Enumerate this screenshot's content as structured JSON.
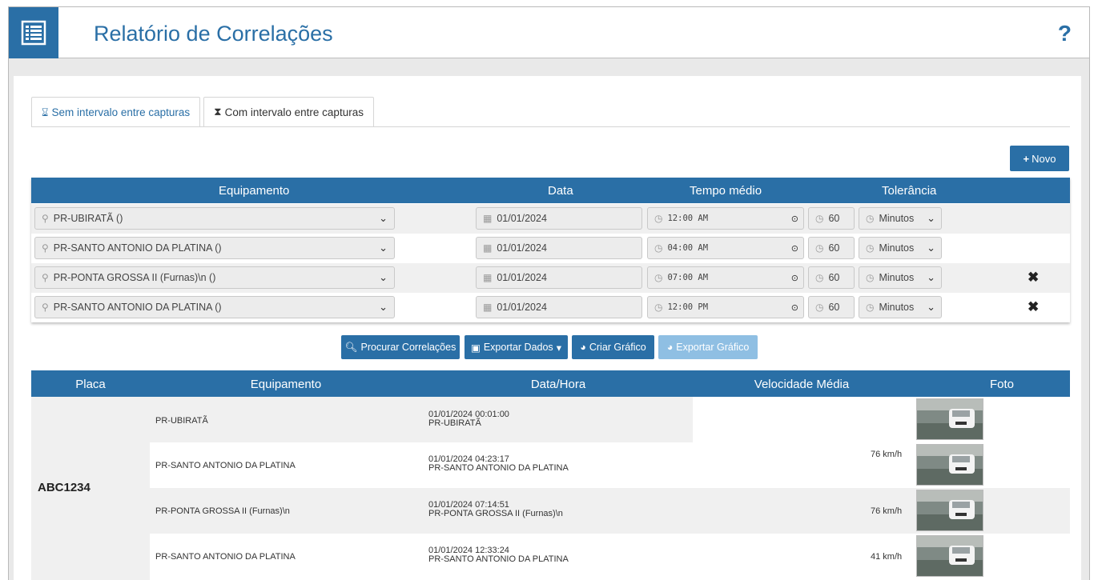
{
  "header": {
    "title": "Relatório de Correlações",
    "help": "?"
  },
  "tabs": [
    {
      "label": "Sem intervalo entre capturas",
      "icon": "hourglass-empty-icon",
      "active": true
    },
    {
      "label": "Com intervalo entre capturas",
      "icon": "hourglass-full-icon",
      "active": false
    }
  ],
  "novo_button": "Novo",
  "correlation_table": {
    "headers": {
      "equipamento": "Equipamento",
      "data": "Data",
      "tempo_medio": "Tempo médio",
      "tolerancia": "Tolerância"
    },
    "rows": [
      {
        "equipamento": "PR-UBIRATÃ ()",
        "data": "01/01/2024",
        "hora": "12:00 AM",
        "tempo": "60",
        "unidade": "Minutos",
        "removable": false
      },
      {
        "equipamento": "PR-SANTO ANTONIO DA PLATINA ()",
        "data": "01/01/2024",
        "hora": "04:00 AM",
        "tempo": "60",
        "unidade": "Minutos",
        "removable": false
      },
      {
        "equipamento": "PR-PONTA GROSSA II (Furnas)\\n ()",
        "data": "01/01/2024",
        "hora": "07:00 AM",
        "tempo": "60",
        "unidade": "Minutos",
        "removable": true
      },
      {
        "equipamento": "PR-SANTO ANTONIO DA PLATINA ()",
        "data": "01/01/2024",
        "hora": "12:00 PM",
        "tempo": "60",
        "unidade": "Minutos",
        "removable": true
      }
    ]
  },
  "actions": {
    "procurar": "Procurar Correlações",
    "exportar_dados": "Exportar Dados",
    "criar_grafico": "Criar Gráfico",
    "exportar_grafico": "Exportar Gráfico"
  },
  "results_table": {
    "headers": {
      "placa": "Placa",
      "equipamento": "Equipamento",
      "data_hora": "Data/Hora",
      "velocidade": "Velocidade Média",
      "foto": "Foto"
    },
    "placa": "ABC1234",
    "rows": [
      {
        "equipamento": "PR-UBIRATÃ",
        "data_hora": "01/01/2024 00:01:00",
        "local": "PR-UBIRATÃ"
      },
      {
        "equipamento": "PR-SANTO ANTONIO DA PLATINA",
        "data_hora": "01/01/2024 04:23:17",
        "local": "PR-SANTO ANTONIO DA PLATINA"
      },
      {
        "equipamento": "PR-PONTA GROSSA II (Furnas)\\n",
        "data_hora": "01/01/2024 07:14:51",
        "local": "PR-PONTA GROSSA II (Furnas)\\n"
      },
      {
        "equipamento": "PR-SANTO ANTONIO DA PLATINA",
        "data_hora": "01/01/2024 12:33:24",
        "local": "PR-SANTO ANTONIO DA PLATINA"
      }
    ],
    "velocidades": [
      "76 km/h",
      "76 km/h",
      "41 km/h"
    ]
  },
  "colors": {
    "primary": "#2a6fa6",
    "disabled": "#8fbfe3"
  }
}
